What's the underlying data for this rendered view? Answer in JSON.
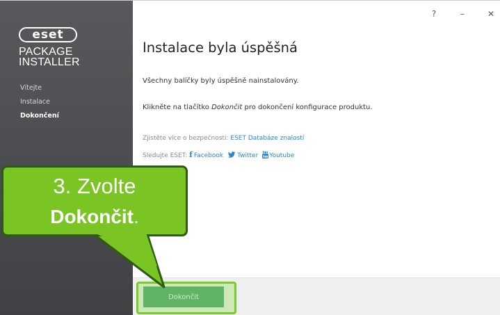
{
  "sidebar": {
    "logo_text": "eset",
    "product_name_line1": "PACKAGE",
    "product_name_line2": "INSTALLER",
    "nav_items": [
      {
        "label": "Vítejte",
        "active": false
      },
      {
        "label": "Instalace",
        "active": false
      },
      {
        "label": "Dokončení",
        "active": true
      }
    ],
    "background_color": "#4f5154"
  },
  "titlebar": {
    "help_label": "?",
    "minimize_label": "–",
    "close_label": "✕"
  },
  "main": {
    "heading": "Instalace byla úspěšná",
    "message1": "Všechny balíčky byly úspěšně nainstalovány.",
    "message2_before": "Klikněte na tlačítko ",
    "message2_em": "Dokončit",
    "message2_after": " pro dokončení konfigurace produktu.",
    "learn_more_label": "Zjistěte více o bezpečnosti: ",
    "knowledgebase_link": "ESET Databáze znalostí",
    "follow_label": "Sledujte ESET: ",
    "facebook_link": "Facebook",
    "twitter_link": "Twitter",
    "youtube_link": "Youtube",
    "link_color": "#2b84d4"
  },
  "footer": {
    "finish_button_label": "Dokončit",
    "button_color": "#5fb466"
  },
  "callout": {
    "line1": "3. Zvolte",
    "line2_bold": "Dokončit",
    "line2_suffix": ".",
    "fill_color": "#7ac523",
    "border_color": "#2d5b10"
  },
  "icons": {
    "facebook": "facebook-icon",
    "twitter": "twitter-icon",
    "youtube": "youtube-icon"
  }
}
